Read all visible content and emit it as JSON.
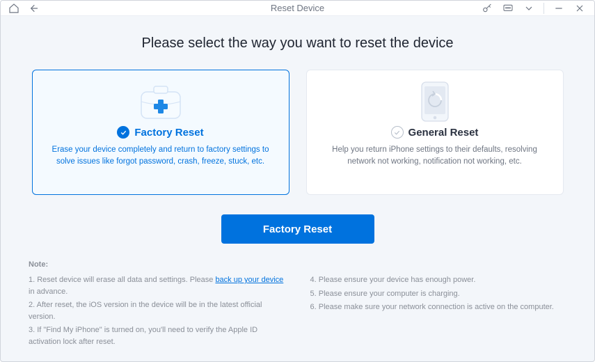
{
  "header": {
    "title": "Reset Device"
  },
  "heading": "Please select the way you want to reset the device",
  "cards": {
    "factory": {
      "title": "Factory Reset",
      "desc": "Erase your device completely and return to factory settings to solve issues like forgot password, crash, freeze, stuck, etc."
    },
    "general": {
      "title": "General Reset",
      "desc": "Help you return iPhone settings to their defaults, resolving network not working, notification not working, etc."
    }
  },
  "button": {
    "label": "Factory Reset"
  },
  "notes": {
    "label": "Note:",
    "link_text": "back up your device",
    "left": [
      {
        "prefix": "1. Reset device will erase all data and settings. Please ",
        "suffix": " in advance."
      },
      {
        "text": "2. After reset, the iOS version in the device will be in the latest official version."
      },
      {
        "text": "3. If \"Find My iPhone\" is turned on, you'll need to verify the Apple ID activation lock after reset."
      }
    ],
    "right": [
      {
        "text": "4. Please ensure your device has enough power."
      },
      {
        "text": "5. Please ensure your computer is charging."
      },
      {
        "text": "6. Please make sure your network connection is active on the computer."
      }
    ]
  }
}
